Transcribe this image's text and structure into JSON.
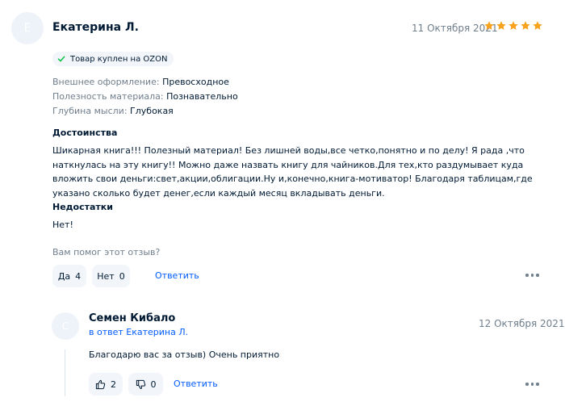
{
  "review": {
    "avatar_letter": "Е",
    "author": "Екатерина Л.",
    "date": "11 Октября 2021",
    "rating": 5,
    "star_color": "#f9a21d",
    "badge": "Товар куплен на OZON",
    "props": [
      {
        "key": "Внешнее оформление:",
        "value": "Превосходное"
      },
      {
        "key": "Полезность материала:",
        "value": "Познавательно"
      },
      {
        "key": "Глубина мысли:",
        "value": "Глубокая"
      }
    ],
    "pros_title": "Достоинства",
    "pros_text": "Шикарная книга!!! Полезный материал! Без лишней воды,все четко,понятно и по делу! Я рада ,что наткнулась на эту книгу!! Можно даже назвать книгу для чайников.Для тех,кто раздумывает куда вложить свои деньги:свет,акции,облигации.Ну и,конечно,книга-мотиватор! Благодаря таблицам,где указано сколько будет денег,если каждый месяц вкладывать деньги.",
    "cons_title": "Недостатки",
    "cons_text": "Нет!",
    "helpful_question": "Вам помог этот отзыв?",
    "yes_label": "Да",
    "yes_count": "4",
    "no_label": "Нет",
    "no_count": "0",
    "reply_label": "Ответить"
  },
  "comment": {
    "avatar_letter": "С",
    "author": "Семен Кибало",
    "date": "12 Октября 2021",
    "in_response": "в ответ Екатерина Л.",
    "text": "Благодарю вас за отзыв) Очень приятно",
    "likes": "2",
    "dislikes": "0",
    "reply_label": "Ответить"
  },
  "colors": {
    "link": "#005bff",
    "muted": "#707f8d",
    "chip_bg": "#f2f5f9",
    "check": "#10c44c"
  }
}
